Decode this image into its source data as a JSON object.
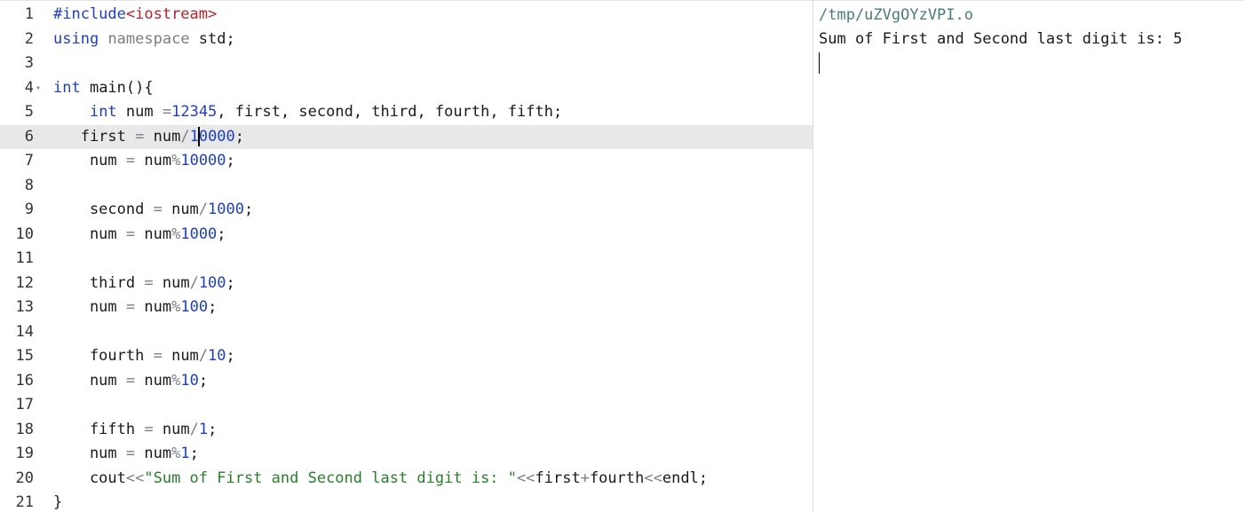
{
  "editor": {
    "lines": [
      {
        "n": "1",
        "parts": [
          [
            "dir",
            "#include"
          ],
          [
            "hdr",
            "<iostream>"
          ]
        ]
      },
      {
        "n": "2",
        "parts": [
          [
            "kw",
            "using"
          ],
          [
            "",
            ""
          ],
          [
            "pl",
            " "
          ],
          [
            "ns",
            "namespace"
          ],
          [
            "pl",
            " std;"
          ]
        ]
      },
      {
        "n": "3",
        "parts": []
      },
      {
        "n": "4",
        "fold": true,
        "parts": [
          [
            "kw",
            "int"
          ],
          [
            "pl",
            " main(){"
          ]
        ]
      },
      {
        "n": "5",
        "parts": [
          [
            "pl",
            "    "
          ],
          [
            "kw",
            "int"
          ],
          [
            "pl",
            " num "
          ],
          [
            "op",
            "="
          ],
          [
            "num",
            "12345"
          ],
          [
            "pl",
            ", first, second, third, fourth, fifth;"
          ]
        ]
      },
      {
        "n": "6",
        "active": true,
        "parts": [
          [
            "pl",
            "   first "
          ],
          [
            "op",
            "="
          ],
          [
            "pl",
            " num"
          ],
          [
            "op",
            "/"
          ],
          [
            "num",
            "1"
          ],
          [
            "caret",
            ""
          ],
          [
            "num",
            "0000"
          ],
          [
            "pl",
            ";"
          ]
        ]
      },
      {
        "n": "7",
        "parts": [
          [
            "pl",
            "    num "
          ],
          [
            "op",
            "="
          ],
          [
            "pl",
            " num"
          ],
          [
            "op",
            "%"
          ],
          [
            "num",
            "10000"
          ],
          [
            "pl",
            ";"
          ]
        ]
      },
      {
        "n": "8",
        "parts": []
      },
      {
        "n": "9",
        "parts": [
          [
            "pl",
            "    second "
          ],
          [
            "op",
            "="
          ],
          [
            "pl",
            " num"
          ],
          [
            "op",
            "/"
          ],
          [
            "num",
            "1000"
          ],
          [
            "pl",
            ";"
          ]
        ]
      },
      {
        "n": "10",
        "parts": [
          [
            "pl",
            "    num "
          ],
          [
            "op",
            "="
          ],
          [
            "pl",
            " num"
          ],
          [
            "op",
            "%"
          ],
          [
            "num",
            "1000"
          ],
          [
            "pl",
            ";"
          ]
        ]
      },
      {
        "n": "11",
        "parts": []
      },
      {
        "n": "12",
        "parts": [
          [
            "pl",
            "    third "
          ],
          [
            "op",
            "="
          ],
          [
            "pl",
            " num"
          ],
          [
            "op",
            "/"
          ],
          [
            "num",
            "100"
          ],
          [
            "pl",
            ";"
          ]
        ]
      },
      {
        "n": "13",
        "parts": [
          [
            "pl",
            "    num "
          ],
          [
            "op",
            "="
          ],
          [
            "pl",
            " num"
          ],
          [
            "op",
            "%"
          ],
          [
            "num",
            "100"
          ],
          [
            "pl",
            ";"
          ]
        ]
      },
      {
        "n": "14",
        "parts": []
      },
      {
        "n": "15",
        "parts": [
          [
            "pl",
            "    fourth "
          ],
          [
            "op",
            "="
          ],
          [
            "pl",
            " num"
          ],
          [
            "op",
            "/"
          ],
          [
            "num",
            "10"
          ],
          [
            "pl",
            ";"
          ]
        ]
      },
      {
        "n": "16",
        "parts": [
          [
            "pl",
            "    num "
          ],
          [
            "op",
            "="
          ],
          [
            "pl",
            " num"
          ],
          [
            "op",
            "%"
          ],
          [
            "num",
            "10"
          ],
          [
            "pl",
            ";"
          ]
        ]
      },
      {
        "n": "17",
        "parts": []
      },
      {
        "n": "18",
        "parts": [
          [
            "pl",
            "    fifth "
          ],
          [
            "op",
            "="
          ],
          [
            "pl",
            " num"
          ],
          [
            "op",
            "/"
          ],
          [
            "num",
            "1"
          ],
          [
            "pl",
            ";"
          ]
        ]
      },
      {
        "n": "19",
        "parts": [
          [
            "pl",
            "    num "
          ],
          [
            "op",
            "="
          ],
          [
            "pl",
            " num"
          ],
          [
            "op",
            "%"
          ],
          [
            "num",
            "1"
          ],
          [
            "pl",
            ";"
          ]
        ]
      },
      {
        "n": "20",
        "parts": [
          [
            "pl",
            "    cout"
          ],
          [
            "op",
            "<<"
          ],
          [
            "str",
            "\"Sum of First and Second last digit is: \""
          ],
          [
            "op",
            "<<"
          ],
          [
            "pl",
            "first"
          ],
          [
            "op",
            "+"
          ],
          [
            "pl",
            "fourth"
          ],
          [
            "op",
            "<<"
          ],
          [
            "pl",
            "endl;"
          ]
        ]
      },
      {
        "n": "21",
        "parts": [
          [
            "pl",
            "}"
          ]
        ]
      }
    ]
  },
  "output": {
    "path": "/tmp/uZVgOYzVPI.o",
    "text": "Sum of First and Second last digit is: 5"
  }
}
